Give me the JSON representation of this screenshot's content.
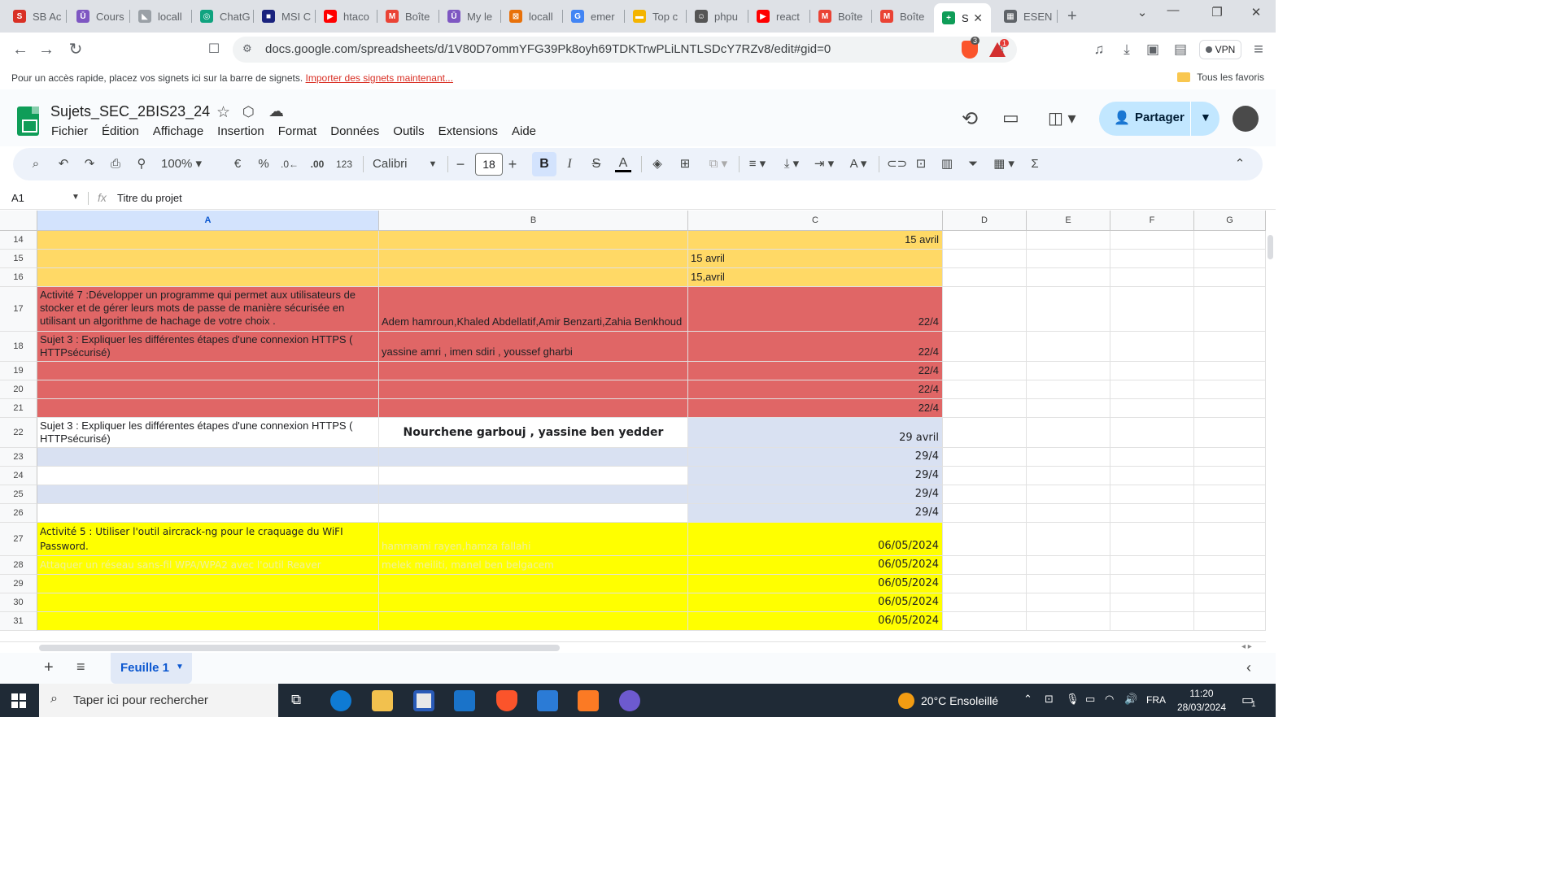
{
  "browser": {
    "tabs": [
      {
        "label": "SB Ac",
        "color": "#d93025",
        "glyph": "S"
      },
      {
        "label": "Cours",
        "color": "#7e57c2",
        "glyph": "Ū"
      },
      {
        "label": "locall",
        "color": "#9aa0a6",
        "glyph": "◣"
      },
      {
        "label": "ChatG",
        "color": "#10a37f",
        "glyph": "◎"
      },
      {
        "label": "MSI C",
        "color": "#1a237e",
        "glyph": "■"
      },
      {
        "label": "htaco",
        "color": "#ff0000",
        "glyph": "▶"
      },
      {
        "label": "Boîte",
        "color": "#ea4335",
        "glyph": "M"
      },
      {
        "label": "My le",
        "color": "#7e57c2",
        "glyph": "Ū"
      },
      {
        "label": "locall",
        "color": "#e8710a",
        "glyph": "⊠"
      },
      {
        "label": "emer",
        "color": "#4285f4",
        "glyph": "G"
      },
      {
        "label": "Top c",
        "color": "#f4b400",
        "glyph": "▬"
      },
      {
        "label": "phpu",
        "color": "#555555",
        "glyph": "☺"
      },
      {
        "label": "react",
        "color": "#ff0000",
        "glyph": "▶"
      },
      {
        "label": "Boîte",
        "color": "#ea4335",
        "glyph": "M"
      },
      {
        "label": "Boîte",
        "color": "#ea4335",
        "glyph": "M"
      },
      {
        "label": "S",
        "color": "#0f9d58",
        "glyph": "+",
        "active": true
      },
      {
        "label": "ESEN",
        "color": "#5f6368",
        "glyph": "▦"
      }
    ],
    "new_tab": "+",
    "url": "docs.google.com/spreadsheets/d/1V80D7ommYFG39Pk8oyh69TDKTrwPLiLNTLSDcY7RZv8/edit#gid=0",
    "vpn_label": "VPN",
    "brave_badge": "3",
    "alert_badge": "1"
  },
  "bookmarks": {
    "text": "Pour un accès rapide, placez vos signets ici sur la barre de signets.",
    "link": "Importer des signets maintenant...",
    "favorites": "Tous les favoris"
  },
  "sheets": {
    "title": "Sujets_SEC_2BIS23_24",
    "menu": [
      "Fichier",
      "Édition",
      "Affichage",
      "Insertion",
      "Format",
      "Données",
      "Outils",
      "Extensions",
      "Aide"
    ],
    "share_label": "Partager",
    "zoom": "100%",
    "currency": "€",
    "percent": "%",
    "dec_less": ".0←",
    "dec_more": ".00",
    "number_fmt": "123",
    "font": "Calibri",
    "font_size": "18",
    "bold": "B",
    "italic": "I",
    "strike": "S",
    "text_color": "A",
    "name_box": "A1",
    "fx": "fx",
    "formula": "Titre du projet",
    "sheet_tab": "Feuille 1"
  },
  "grid": {
    "columns": [
      "A",
      "B",
      "C",
      "D",
      "E",
      "F",
      "G"
    ],
    "selected_column": "A",
    "colors": {
      "orange": "#ffd966",
      "red": "#e06666",
      "lavender": "#d9e1f2",
      "white": "#ffffff",
      "yellow": "#ffff00"
    },
    "rows": [
      {
        "n": "14",
        "fill": "orange",
        "a": "",
        "b": "",
        "c": "15 avril",
        "c_align": "right"
      },
      {
        "n": "15",
        "fill": "orange",
        "a": "",
        "b": "",
        "c": "15 avril",
        "c_align": "left"
      },
      {
        "n": "16",
        "fill": "orange",
        "a": "",
        "b": "",
        "c": "15,avril",
        "c_align": "left"
      },
      {
        "n": "17",
        "fill": "red",
        "a": "Activité 7 :Développer un programme qui permet aux utilisateurs de stocker et de gérer leurs mots de passe de manière sécurisée en utilisant un algorithme de hachage de votre choix .",
        "b": "Adem hamroun,Khaled Abdellatif,Amir Benzarti,Zahia Benkhoud",
        "c": "22/4",
        "c_align": "right"
      },
      {
        "n": "18",
        "fill": "red",
        "a": "Sujet 3 : Expliquer les différentes étapes d'une connexion HTTPS ( HTTPsécurisé)",
        "b": "yassine amri , imen sdiri , youssef gharbi",
        "c": "22/4",
        "c_align": "right"
      },
      {
        "n": "19",
        "fill": "red",
        "a": "",
        "b": "",
        "c": "22/4",
        "c_align": "right"
      },
      {
        "n": "20",
        "fill": "red",
        "a": "",
        "b": "",
        "c": "22/4",
        "c_align": "right"
      },
      {
        "n": "21",
        "fill": "red",
        "a": "",
        "b": "",
        "c": "22/4",
        "c_align": "right"
      },
      {
        "n": "22",
        "fill": "white",
        "a": "Sujet 3 : Expliquer les différentes étapes d'une connexion HTTPS ( HTTPsécurisé)",
        "b": "Nourchene garbouj , yassine ben yedder",
        "c": "29 avril",
        "c_align": "right",
        "b_bold": true,
        "c_fill": "lavender"
      },
      {
        "n": "23",
        "fill": "lavender",
        "a": "",
        "b": "",
        "c": "29/4",
        "c_align": "right"
      },
      {
        "n": "24",
        "fill": "white",
        "a": "",
        "b": "",
        "c": "29/4",
        "c_align": "right",
        "c_fill": "lavender"
      },
      {
        "n": "25",
        "fill": "lavender",
        "a": "",
        "b": "",
        "c": "29/4",
        "c_align": "right"
      },
      {
        "n": "26",
        "fill": "white",
        "a": "",
        "b": "",
        "c": "29/4",
        "c_align": "right",
        "c_fill": "lavender"
      },
      {
        "n": "27",
        "fill": "yellow",
        "a": "Activité 5 : Utiliser l'outil aircrack-ng pour le craquage du WiFI Password.",
        "b": "hammami rayen,hamza fallahi",
        "c": "06/05/2024",
        "c_align": "right",
        "b_faint": true
      },
      {
        "n": "28",
        "fill": "yellow",
        "a": "Attaquer un réseau sans-fil WPA/WPA2 avec l'outil Reaver",
        "b": "melek meiliti, manel ben belgacem",
        "c": "06/05/2024",
        "c_align": "right",
        "a_faint": true,
        "b_faint": true
      },
      {
        "n": "29",
        "fill": "yellow",
        "a": "",
        "b": "",
        "c": "06/05/2024",
        "c_align": "right"
      },
      {
        "n": "30",
        "fill": "yellow",
        "a": "",
        "b": "",
        "c": "06/05/2024",
        "c_align": "right"
      },
      {
        "n": "31",
        "fill": "yellow",
        "a": "",
        "b": "",
        "c": "06/05/2024",
        "c_align": "right"
      }
    ]
  },
  "taskbar": {
    "search": "Taper ici pour rechercher",
    "weather": "20°C  Ensoleillé",
    "lang": "FRA",
    "time": "11:20",
    "date": "28/03/2024",
    "notif_count": "1"
  }
}
